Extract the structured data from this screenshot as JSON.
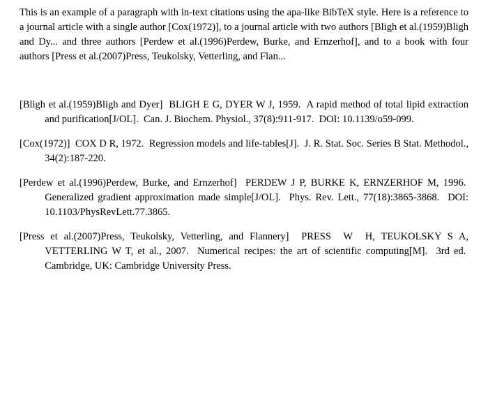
{
  "intro": {
    "text": "This is an example of a paragraph with in-text citations using the apa-like BibTeX style.  Here is a reference to a journal article with a single author [Cox(1972)], to a journal article with two authors [Bligh et al.(1959)Bligh and Dy... and three authors [Perdew et al.(1996)Perdew, Burke, and Ernzerhof], and to a book with four authors [Press et al.(2007)Press, Teukolsky, Vetterling, and Flan..."
  },
  "references": [
    {
      "key": "[Bligh et al.(1959)Bligh and Dyer]",
      "body": "BLIGH E G, DYER W J, 1959.  A rapid method of total lipid extraction and purification[J/OL].  Can. J. Biochem. Physiol., 37(8):911-917.  DOI: 10.1139/o59-099."
    },
    {
      "key": "[Cox(1972)]",
      "body": "COX D R, 1972.  Regression models and life-tables[J].  J. R. Stat. Soc. Series B Stat. Methodol., 34(2):187-220."
    },
    {
      "key": "[Perdew et al.(1996)Perdew, Burke, and Ernzerhof]",
      "body": "PERDEW J P, BURKE K, ERNZERHOF M, 1996.  Generalized gradient approximation made simple[J/OL].  Phys. Rev. Lett., 77(18):3865-3868.  DOI: 10.1103/PhysRevLett.77.3865."
    },
    {
      "key": "[Press et al.(2007)Press, Teukolsky, Vetterling, and Flannery]",
      "body": "PRESS W H, TEUKOLSKY S A, VETTERLING W T, et al., 2007.  Numerical recipes: the art of scientific computing[M].  3rd ed.  Cambridge, UK: Cambridge University Press."
    }
  ]
}
